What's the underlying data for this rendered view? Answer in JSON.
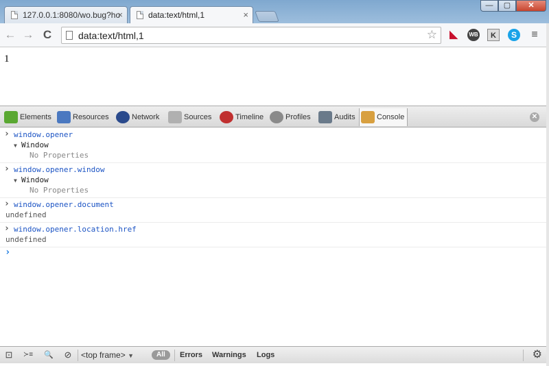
{
  "tabs": [
    {
      "title": "127.0.0.1:8080/wo.bug?ho",
      "active": false
    },
    {
      "title": "data:text/html,1",
      "active": true
    }
  ],
  "window_controls": {
    "minimize": "—",
    "maximize": "▢",
    "close": "✕"
  },
  "toolbar": {
    "back_icon": "←",
    "forward_icon": "→",
    "reload_icon": "C",
    "address": "data:text/html,1",
    "star_icon": "☆",
    "ext_wb": "WB",
    "ext_k": "K",
    "ext_skype": "S",
    "menu_icon": "≡"
  },
  "page": {
    "body_text": "1"
  },
  "devtools": {
    "tabs": [
      {
        "label": "Elements",
        "icon": "elements-icon",
        "color": "#5aa832"
      },
      {
        "label": "Resources",
        "icon": "resources-icon",
        "color": "#4a78c0"
      },
      {
        "label": "Network",
        "icon": "network-icon",
        "color": "#2a4a8c"
      },
      {
        "label": "Sources",
        "icon": "sources-icon",
        "color": "#b0b0b0"
      },
      {
        "label": "Timeline",
        "icon": "timeline-icon",
        "color": "#c03030"
      },
      {
        "label": "Profiles",
        "icon": "profiles-icon",
        "color": "#8a8a8a"
      },
      {
        "label": "Audits",
        "icon": "audits-icon",
        "color": "#6a7a8a"
      },
      {
        "label": "Console",
        "icon": "console-icon",
        "color": "#d8a040",
        "active": true
      }
    ],
    "close_icon": "✕",
    "console": {
      "entries": [
        {
          "command": "window.opener",
          "object": "Window",
          "detail": "No Properties"
        },
        {
          "command": "window.opener.window",
          "object": "Window",
          "detail": "No Properties"
        },
        {
          "command": "window.opener.document",
          "result": "undefined"
        },
        {
          "command": "window.opener.location.href",
          "result": "undefined"
        }
      ]
    },
    "statusbar": {
      "dock_icon": "⊡",
      "drawer_icon": "≻≡",
      "search_icon": "🔍",
      "clear_icon": "⊘",
      "frame_select": "<top frame>",
      "dropdown_icon": "▼",
      "filter_all": "All",
      "filter_errors": "Errors",
      "filter_warnings": "Warnings",
      "filter_logs": "Logs",
      "settings_icon": "⚙"
    }
  }
}
